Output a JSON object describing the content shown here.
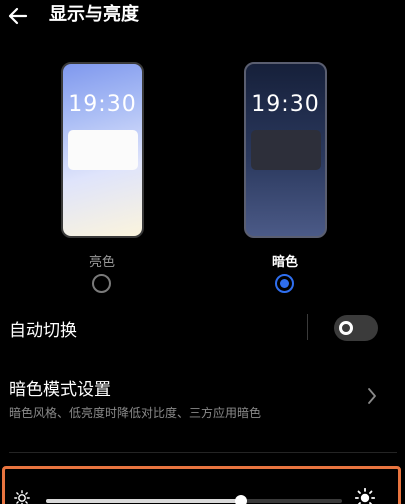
{
  "header": {
    "title": "显示与亮度",
    "back_icon": "arrow-left-icon"
  },
  "themes": {
    "light": {
      "time": "19:30",
      "label": "亮色",
      "selected": false
    },
    "dark": {
      "time": "19:30",
      "label": "暗色",
      "selected": true
    }
  },
  "auto_switch": {
    "label": "自动切换",
    "enabled": false
  },
  "dark_mode_settings": {
    "title": "暗色模式设置",
    "subtitle": "暗色风格、低亮度时降低对比度、三方应用暗色",
    "chevron_icon": "chevron-right-icon"
  },
  "brightness": {
    "level": 0.66,
    "min_icon": "sun-small-icon",
    "max_icon": "sun-large-icon",
    "highlight_color": "#e8743f"
  },
  "colors": {
    "accent": "#2f6ff0",
    "background": "#000000"
  }
}
